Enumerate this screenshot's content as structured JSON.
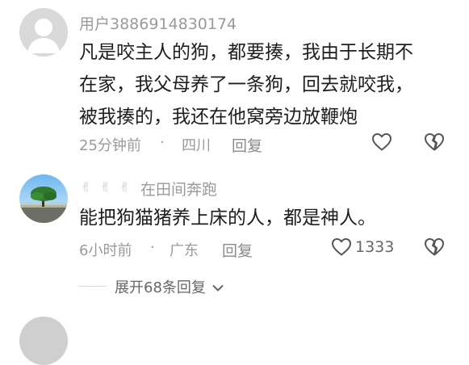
{
  "comments": [
    {
      "username": "用户3886914830174",
      "text": "凡是咬主人的狗，都要揍，我由于长期不\n在家，我父母养了一条狗，回去就咬我，\n被我揍的，我还在他窝旁边放鞭炮",
      "time": "25分钟前",
      "dot": "·",
      "location": "四川",
      "reply_label": "回复",
      "like_count": "",
      "like_icon": "heart-outline-icon",
      "dislike_icon": "broken-heart-icon"
    },
    {
      "username": "在田间奔跑",
      "badges": [
        "✌",
        "✌",
        "✌"
      ],
      "text": "能把狗猫猪养上床的人，都是神人。",
      "time": "6小时前",
      "dot": "·",
      "location": "广东",
      "reply_label": "回复",
      "like_count": "1333",
      "like_icon": "heart-outline-icon",
      "dislike_icon": "broken-heart-icon"
    }
  ],
  "expand": {
    "label": "展开68条回复",
    "icon": "chevron-down-icon"
  }
}
